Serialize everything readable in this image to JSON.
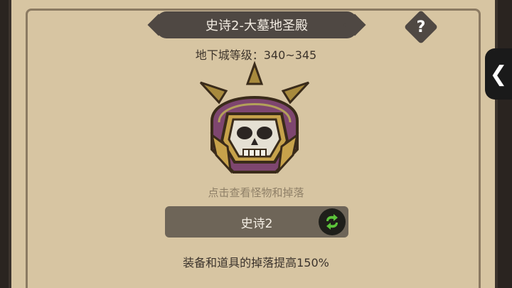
{
  "title": "史诗2-大墓地圣殿",
  "help_label": "?",
  "dungeon_level": "地下城等级：340~345",
  "boss_icon": "skull-helmet-icon",
  "hint": "点击查看怪物和掉落",
  "difficulty": "史诗2",
  "switch_icon": "swap-arrows-icon",
  "bonus": "装备和道具的掉落提高150%",
  "side_tab_icon": "chevron-left-icon",
  "colors": {
    "panel": "#d7c5a2",
    "banner": "#4f4843",
    "button": "#6e6558",
    "switch_green": "#5cc43a"
  }
}
